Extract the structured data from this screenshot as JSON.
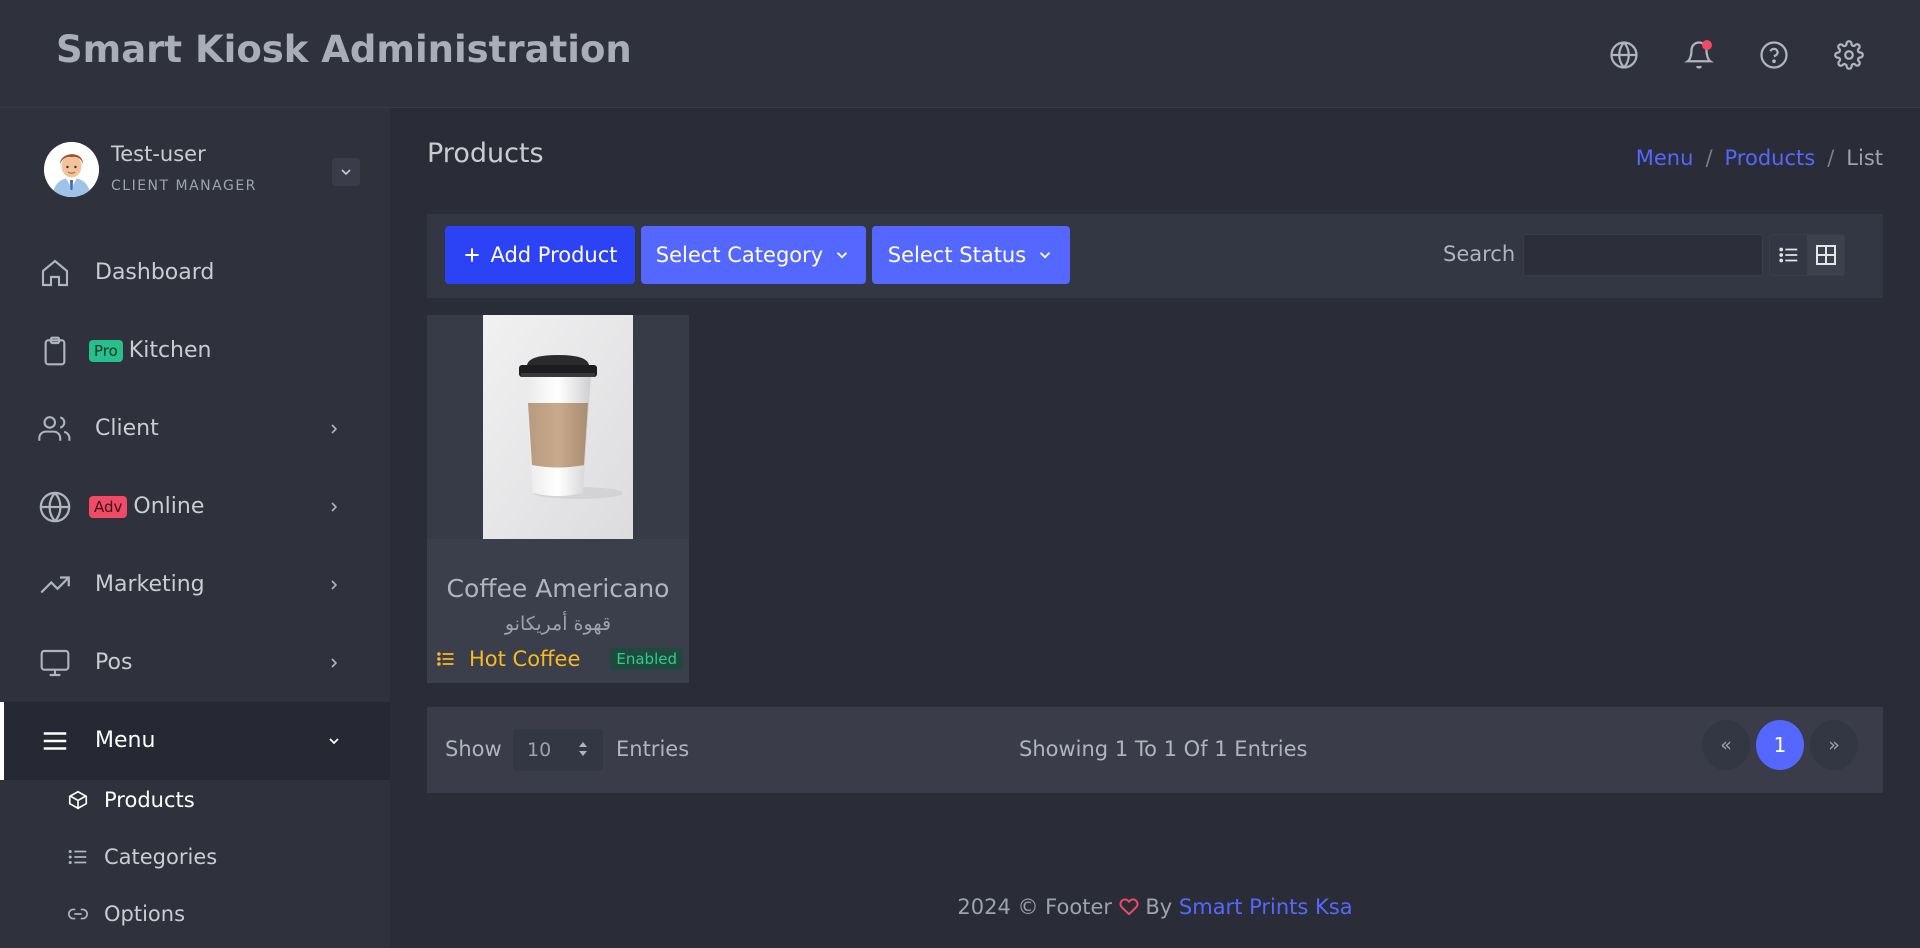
{
  "header": {
    "app_title": "Smart Kiosk Administration",
    "icons": [
      "globe-icon",
      "bell-icon",
      "help-icon",
      "gear-icon"
    ]
  },
  "user": {
    "name": "Test-user",
    "role": "CLIENT MANAGER"
  },
  "sidebar": {
    "items": [
      {
        "label": "Dashboard",
        "icon": "home-icon"
      },
      {
        "label": "Kitchen",
        "icon": "clipboard-icon",
        "badge": "Pro"
      },
      {
        "label": "Client",
        "icon": "users-icon"
      },
      {
        "label": "Online",
        "icon": "globe-icon",
        "badge": "Adv"
      },
      {
        "label": "Marketing",
        "icon": "trending-up-icon"
      },
      {
        "label": "Pos",
        "icon": "monitor-icon"
      },
      {
        "label": "Menu",
        "icon": "menu-icon"
      }
    ],
    "subitems": [
      {
        "label": "Products",
        "icon": "box-icon"
      },
      {
        "label": "Categories",
        "icon": "list-icon"
      },
      {
        "label": "Options",
        "icon": "link-icon"
      }
    ]
  },
  "page": {
    "title": "Products",
    "breadcrumb": [
      "Menu",
      "Products",
      "List"
    ]
  },
  "toolbar": {
    "add_label": "Add Product",
    "category_label": "Select Category",
    "status_label": "Select Status",
    "search_label": "Search",
    "search_value": ""
  },
  "products": [
    {
      "name": "Coffee Americano",
      "name_ar": "قهوة أمريكانو",
      "category": "Hot Coffee",
      "status": "Enabled"
    }
  ],
  "pagination": {
    "show_label": "Show",
    "page_size": "10",
    "entries_label": "Entries",
    "summary": "Showing 1 To 1 Of 1 Entries",
    "prev": "«",
    "current": "1",
    "next": "»"
  },
  "footer": {
    "prefix": "2024 © Footer",
    "by": "By",
    "brand": "Smart Prints Ksa"
  },
  "colors": {
    "accent": "#5468ff",
    "primary_button": "#2c43f5",
    "success": "#27c08c",
    "danger": "#f04a66",
    "warning": "#f7b924"
  }
}
